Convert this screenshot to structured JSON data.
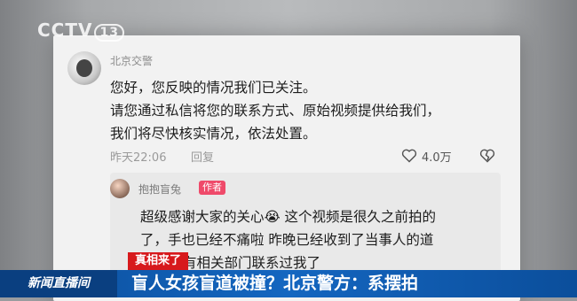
{
  "broadcast": {
    "logo": "CCTV",
    "channel": "13",
    "tag": "真相来了",
    "program": "新闻直播间",
    "headline": "盲人女孩盲道被撞？北京警方：系摆拍"
  },
  "comment": {
    "author": "北京交警",
    "lines": [
      "您好，您反映的情况我们已关注。",
      "请您通过私信将您的联系方式、原始视频提供给我们，",
      "我们将尽快核实情况，依法处置。"
    ],
    "time": "昨天22:06",
    "reply_label": "回复",
    "likes": "4.0万"
  },
  "reply": {
    "author": "抱抱盲兔",
    "badge": "作者",
    "lines": [
      "超级感谢大家的关心😭 这个视频是很久之前拍的",
      "了，手也已经不痛啦 昨晚已经收到了当事人的道",
      "有相关部门联系过我了"
    ]
  },
  "icons": {
    "like": "heart-outline-icon",
    "dislike": "broken-heart-icon"
  }
}
